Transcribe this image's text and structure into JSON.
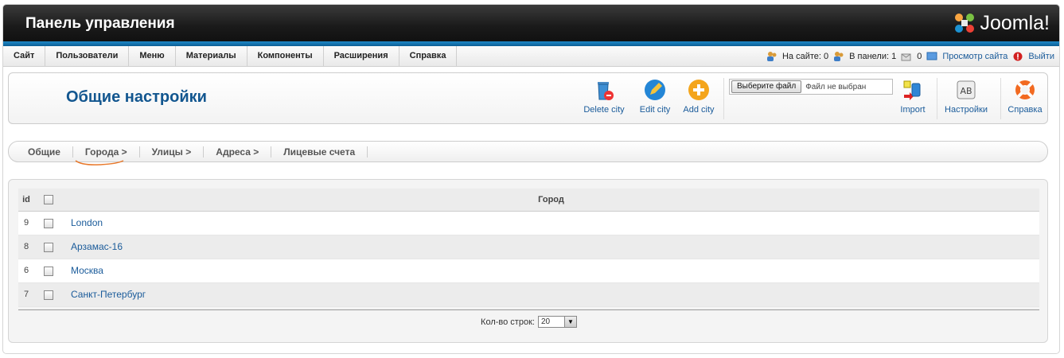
{
  "header": {
    "title": "Панель управления",
    "logo_text": "Joomla!"
  },
  "menu": {
    "items": [
      "Сайт",
      "Пользователи",
      "Меню",
      "Материалы",
      "Компоненты",
      "Расширения",
      "Справка"
    ]
  },
  "status": {
    "on_site": "На сайте: 0",
    "in_panel": "В панели: 1",
    "messages": "0",
    "view_site": "Просмотр сайта",
    "logout": "Выйти"
  },
  "toolbar": {
    "page_title": "Общие настройки",
    "delete_label": "Delete city",
    "edit_label": "Edit city",
    "add_label": "Add city",
    "file_button": "Выберите файл",
    "file_status": "Файл не выбран",
    "import_label": "Import",
    "settings_label": "Настройки",
    "help_label": "Справка"
  },
  "subnav": {
    "items": [
      "Общие",
      "Города >",
      "Улицы >",
      "Адреса >",
      "Лицевые счета"
    ]
  },
  "table": {
    "headers": {
      "id": "id",
      "name": "Город"
    },
    "rows": [
      {
        "id": "9",
        "name": "London"
      },
      {
        "id": "8",
        "name": "Арзамас-16"
      },
      {
        "id": "6",
        "name": "Москва"
      },
      {
        "id": "7",
        "name": "Санкт-Петербург"
      }
    ]
  },
  "pagination": {
    "label": "Кол-во строк:",
    "value": "20"
  },
  "colors": {
    "accent": "#12568f",
    "link": "#1a5b9a",
    "header_bg": "#1a1a1a",
    "strip": "#1e88c7",
    "underline": "#e8782a"
  }
}
